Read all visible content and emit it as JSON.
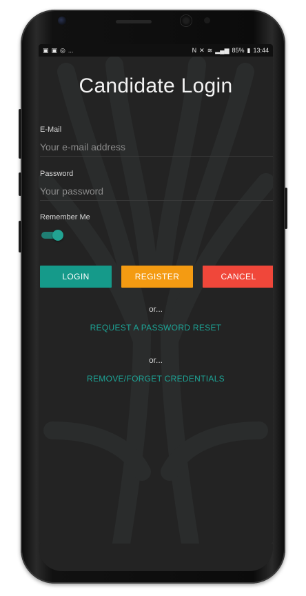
{
  "statusbar": {
    "left_icons": [
      "image-icon",
      "image-icon",
      "sync-icon"
    ],
    "left_more": "...",
    "battery": "85%",
    "time": "13:44"
  },
  "login": {
    "title": "Candidate Login",
    "email_label": "E-Mail",
    "email_placeholder": "Your e-mail address",
    "password_label": "Password",
    "password_placeholder": "Your password",
    "remember_label": "Remember Me",
    "remember_on": true,
    "login_button": "LOGIN",
    "register_button": "REGISTER",
    "cancel_button": "CANCEL",
    "or_1": "or...",
    "reset_link": "REQUEST A PASSWORD RESET",
    "or_2": "or...",
    "forget_link": "REMOVE/FORGET CREDENTIALS"
  },
  "colors": {
    "background": "#232323",
    "accent": "#159a8a",
    "register": "#f49b12",
    "cancel": "#f0473a",
    "link": "#1da597"
  }
}
